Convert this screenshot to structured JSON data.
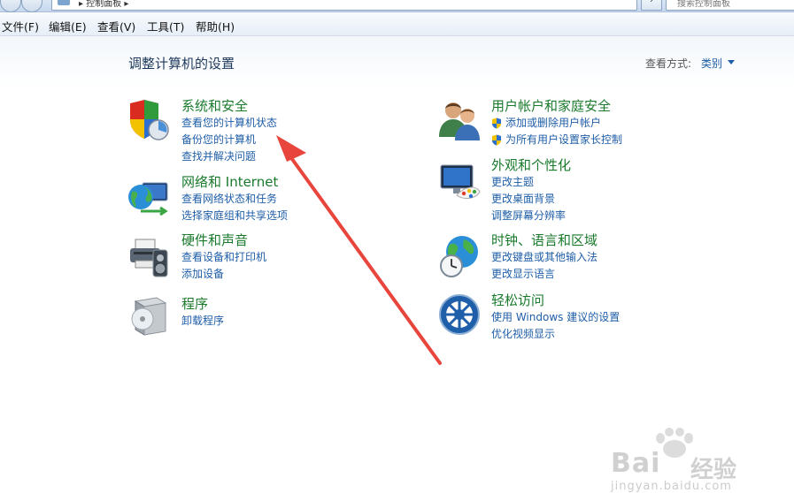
{
  "toolbar": {
    "address_text": "▸ 控制面板 ▸",
    "search_placeholder": "搜索控制面板"
  },
  "menu": [
    "文件(F)",
    "编辑(E)",
    "查看(V)",
    "工具(T)",
    "帮助(H)"
  ],
  "header": {
    "title": "调整计算机的设置",
    "view_by_label": "查看方式:",
    "view_by_value": "类别"
  },
  "categories": [
    {
      "title": "系统和安全",
      "icon": "shield-icon",
      "links": [
        "查看您的计算机状态",
        "备份您的计算机",
        "查找并解决问题"
      ]
    },
    {
      "title": "网络和 Internet",
      "icon": "network-globe-icon",
      "links": [
        "查看网络状态和任务",
        "选择家庭组和共享选项"
      ]
    },
    {
      "title": "硬件和声音",
      "icon": "printer-speaker-icon",
      "links": [
        "查看设备和打印机",
        "添加设备"
      ]
    },
    {
      "title": "程序",
      "icon": "programs-box-icon",
      "links": [
        "卸载程序"
      ]
    },
    {
      "title": "用户帐户和家庭安全",
      "icon": "users-icon",
      "links": [
        "添加或删除用户帐户",
        "为所有用户设置家长控制"
      ]
    },
    {
      "title": "外观和个性化",
      "icon": "monitor-palette-icon",
      "links": [
        "更改主题",
        "更改桌面背景",
        "调整屏幕分辨率"
      ]
    },
    {
      "title": "时钟、语言和区域",
      "icon": "globe-clock-icon",
      "links": [
        "更改键盘或其他输入法",
        "更改显示语言"
      ]
    },
    {
      "title": "轻松访问",
      "icon": "ease-of-access-icon",
      "links": [
        "使用 Windows 建议的设置",
        "优化视频显示"
      ]
    }
  ],
  "annotation": {
    "color": "#e8453c"
  },
  "watermark": {
    "brand": "Bai",
    "brand2": "经验",
    "url": "jingyan.baidu.com"
  }
}
